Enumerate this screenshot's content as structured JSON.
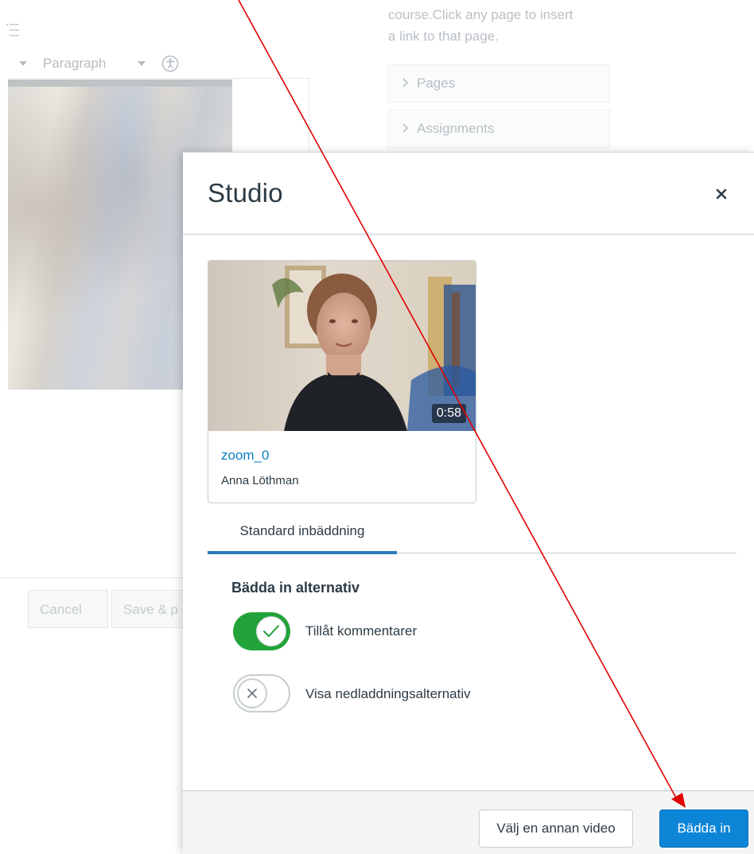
{
  "background": {
    "toolbar": {
      "format_label": "Paragraph"
    },
    "links_panel": {
      "intro_line1": "course.Click any page to insert",
      "intro_line2": "a link to that page.",
      "items": [
        {
          "label": "Pages"
        },
        {
          "label": "Assignments"
        }
      ]
    },
    "footer": {
      "cancel_label": "Cancel",
      "save_label": "Save & p"
    }
  },
  "modal": {
    "title": "Studio",
    "close_icon": "close-icon",
    "video": {
      "duration": "0:58",
      "title": "zoom_0",
      "author": "Anna Löthman"
    },
    "tabs": [
      {
        "label": "Standard inbäddning",
        "active": true
      }
    ],
    "options": {
      "heading": "Bädda in alternativ",
      "toggles": [
        {
          "label": "Tillåt kommentarer",
          "on": true
        },
        {
          "label": "Visa nedladdningsalternativ",
          "on": false
        }
      ]
    },
    "footer": {
      "secondary_label": "Välj en annan video",
      "primary_label": "Bädda in"
    }
  },
  "colors": {
    "accent_blue": "#0d85d7",
    "toggle_on": "#22a339",
    "annotation_arrow": "#e00000"
  }
}
